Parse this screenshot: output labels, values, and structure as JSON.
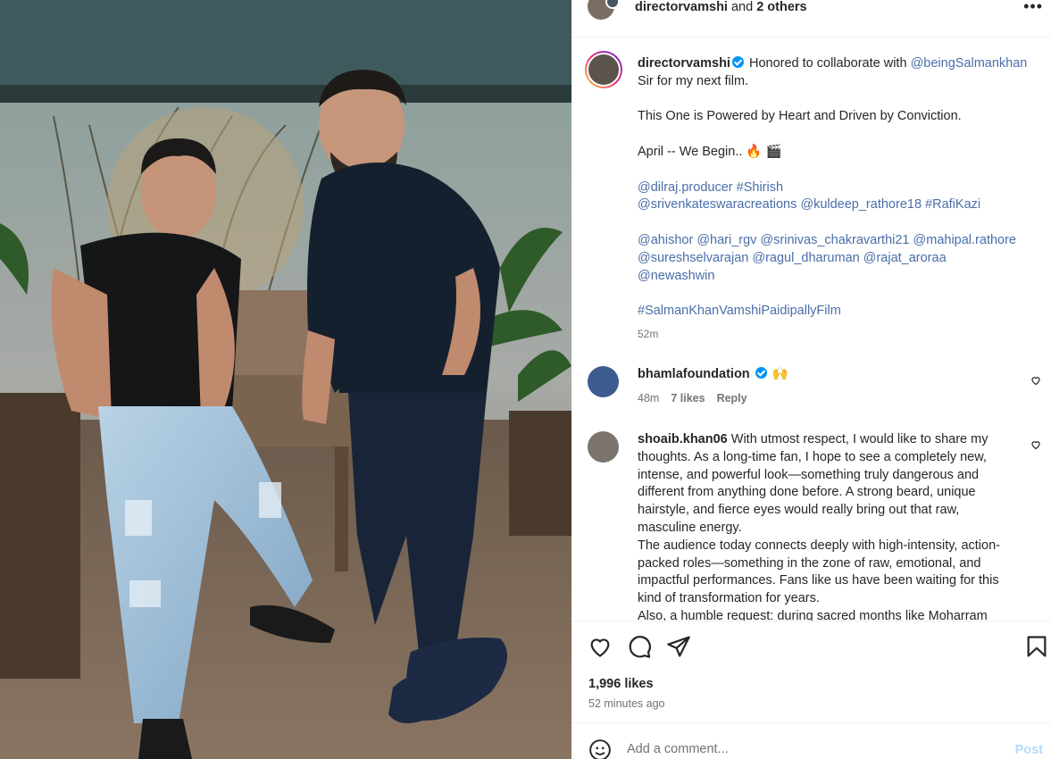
{
  "post_image": {
    "alt_icon": "photo"
  },
  "header": {
    "username": "directorvamshi",
    "and_text": " and ",
    "others": "2 others",
    "more_icon": "more-horizontal-icon"
  },
  "caption": {
    "username": "directorvamshi",
    "line1": " Honored to collaborate with",
    "mention1": "@beingSalmankhan",
    "line1b": " Sir for my next film.",
    "line2": "This One is Powered by Heart and Driven by Conviction.",
    "line3": "April -- We Begin.. 🔥 🎬",
    "tags_a": [
      "@dilraj.producer",
      "#Shirish"
    ],
    "tags_b": [
      "@srivenkateswaracreations",
      "@kuldeep_rathore18",
      "#RafiKazi"
    ],
    "tags_c": [
      "@ahishor",
      "@hari_rgv",
      "@srinivas_chakravarthi21",
      "@mahipal.rathore"
    ],
    "tags_d": [
      "@sureshselvarajan",
      "@ragul_dharuman",
      "@rajat_aroraa"
    ],
    "tags_e": [
      "@newashwin"
    ],
    "hashtag": "#SalmanKhanVamshiPaidipallyFilm",
    "time": "52m"
  },
  "comments": [
    {
      "username": "bhamlafoundation",
      "text": " 🙌",
      "time": "48m",
      "likes": "7 likes",
      "reply": "Reply"
    },
    {
      "username": "shoaib.khan06",
      "p1": " With utmost respect, I would like to share my thoughts. As a long-time fan, I hope to see a completely new, intense, and powerful look—something truly dangerous and different from anything done before. A strong beard, unique hairstyle, and fierce eyes would really bring out that raw, masculine energy.",
      "p2": "The audience today connects deeply with high-intensity, action-packed roles—something in the zone of raw, emotional, and impactful performances. Fans like us have been waiting for this kind of transformation for years.",
      "p3": "Also, a humble request: during sacred months like Moharram"
    }
  ],
  "actions": {
    "likes": "1,996 likes",
    "ago": "52 minutes ago"
  },
  "add_comment": {
    "placeholder": "Add a comment...",
    "post": "Post"
  }
}
